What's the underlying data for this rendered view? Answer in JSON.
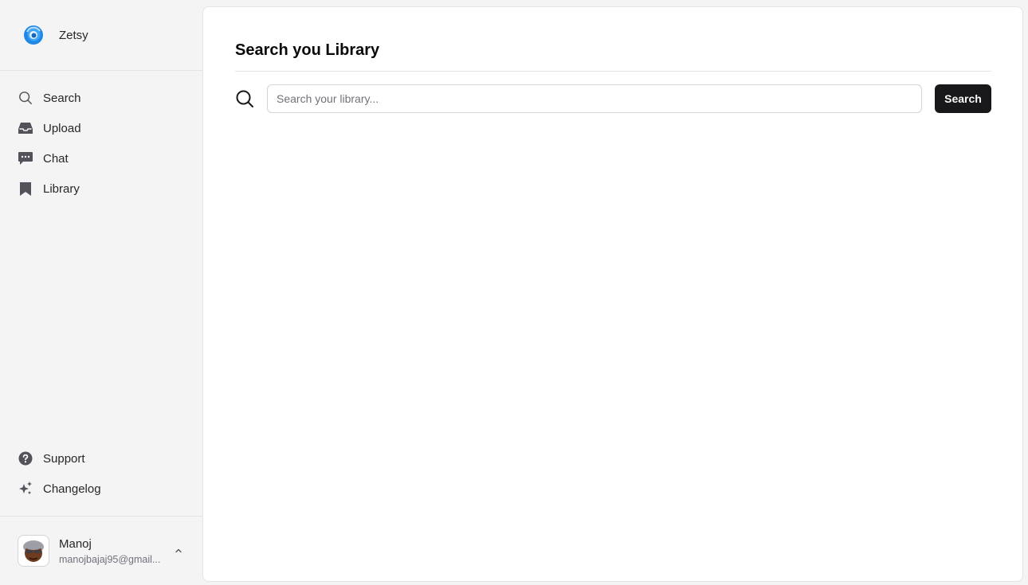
{
  "brand": {
    "name": "Zetsy",
    "logo_icon": "swirl-logo-icon"
  },
  "nav": [
    {
      "label": "Search",
      "icon": "search-icon"
    },
    {
      "label": "Upload",
      "icon": "inbox-icon"
    },
    {
      "label": "Chat",
      "icon": "chat-icon"
    },
    {
      "label": "Library",
      "icon": "bookmark-icon"
    }
  ],
  "bottom_nav": [
    {
      "label": "Support",
      "icon": "help-icon"
    },
    {
      "label": "Changelog",
      "icon": "sparkles-icon"
    }
  ],
  "user": {
    "name": "Manoj",
    "email": "manojbajaj95@gmail..."
  },
  "main": {
    "title": "Search you Library",
    "search": {
      "placeholder": "Search your library...",
      "value": "",
      "button_label": "Search"
    }
  },
  "colors": {
    "accent": "#18181b",
    "sidebar_bg": "#f4f4f5",
    "logo_blue": "#1e88e5"
  }
}
